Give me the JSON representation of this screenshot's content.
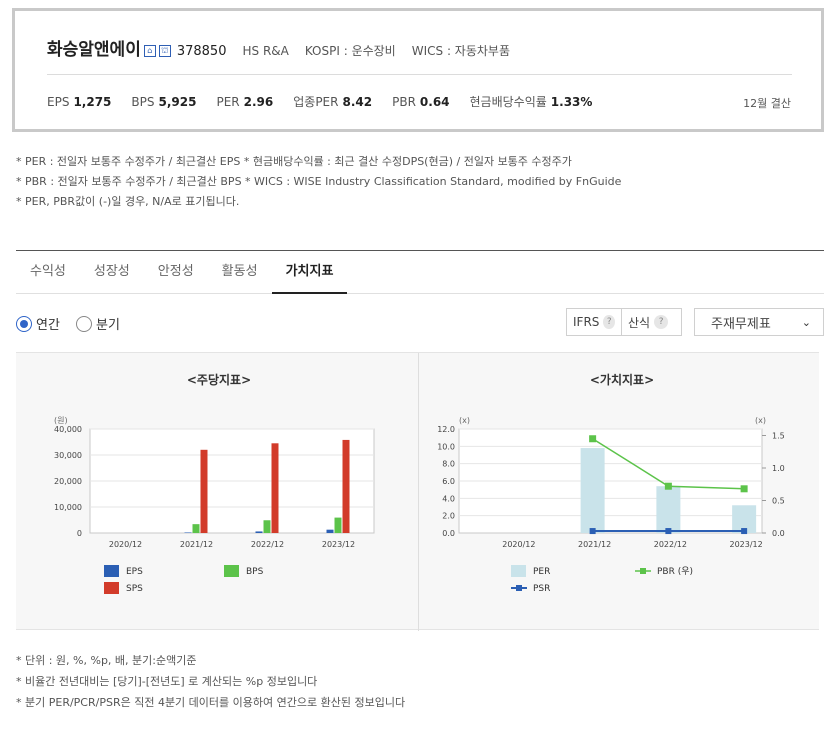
{
  "header": {
    "corp_name": "화승알앤에이",
    "icon_a": "⌂",
    "icon_b": "⛫",
    "code": "378850",
    "english_name": "HS R&A",
    "market": "KOSPI : 운수장비",
    "wics": "WICS : 자동차부품",
    "metrics": [
      {
        "label": "EPS",
        "value": "1,275"
      },
      {
        "label": "BPS",
        "value": "5,925"
      },
      {
        "label": "PER",
        "value": "2.96"
      },
      {
        "label": "업종PER",
        "value": "8.42"
      },
      {
        "label": "PBR",
        "value": "0.64"
      },
      {
        "label": "현금배당수익률",
        "value": "1.33%"
      }
    ],
    "settlement": "12월 결산"
  },
  "notes_top": [
    "* PER : 전일자 보통주 수정주가 / 최근결산 EPS * 현금배당수익률 : 최근 결산 수정DPS(현금) / 전일자 보통주 수정주가",
    "* PBR : 전일자 보통주 수정주가 / 최근결산 BPS * WICS : WISE Industry Classification Standard, modified by FnGuide",
    "* PER, PBR값이 (-)일 경우, N/A로 표기됩니다."
  ],
  "tabs": [
    "수익성",
    "성장성",
    "안정성",
    "활동성",
    "가치지표"
  ],
  "active_tab": 4,
  "controls": {
    "annual_label": "연간",
    "quarter_label": "분기",
    "ifrs_label": "IFRS",
    "calc_label": "산식",
    "help_glyph": "?",
    "select_value": "주재무제표",
    "chevron": "⌄"
  },
  "colors": {
    "eps": "#2b5fb4",
    "bps": "#5cc34a",
    "sps": "#d23b2a",
    "per": "#c9e3ea",
    "pbr": "#5cc34a",
    "psr": "#2b5fb4"
  },
  "chart_data": [
    {
      "type": "bar",
      "title": "<주당지표>",
      "ylabel": "(원)",
      "categories": [
        "2020/12",
        "2021/12",
        "2022/12",
        "2023/12"
      ],
      "ylim": [
        0,
        40000
      ],
      "yticks": [
        "0",
        "10,000",
        "20,000",
        "30,000",
        "40,000"
      ],
      "series": [
        {
          "name": "EPS",
          "values": [
            null,
            200,
            600,
            1275
          ]
        },
        {
          "name": "BPS",
          "values": [
            null,
            3400,
            4900,
            5925
          ]
        },
        {
          "name": "SPS",
          "values": [
            null,
            32000,
            34500,
            35800
          ]
        }
      ]
    },
    {
      "type": "bar",
      "title": "<가치지표>",
      "ylabel": "(x)",
      "y2label": "(x)",
      "categories": [
        "2020/12",
        "2021/12",
        "2022/12",
        "2023/12"
      ],
      "ylim": [
        0,
        12
      ],
      "yticks": [
        "0.0",
        "2.0",
        "4.0",
        "6.0",
        "8.0",
        "10.0",
        "12.0"
      ],
      "y2lim": [
        0,
        1.6
      ],
      "y2ticks": [
        "0.0",
        "0.5",
        "1.0",
        "1.5"
      ],
      "series": [
        {
          "name": "PER",
          "values": [
            null,
            9.8,
            5.4,
            3.2
          ]
        },
        {
          "name": "PBR (우)",
          "values": [
            null,
            1.45,
            0.72,
            0.68
          ]
        },
        {
          "name": "PSR",
          "values": [
            null,
            0.03,
            0.03,
            0.03
          ]
        }
      ]
    }
  ],
  "notes_bottom": [
    "* 단위 : 원, %, %p, 배, 분기:순액기준",
    "* 비율간 전년대비는 [당기]-[전년도] 로 계산되는 %p 정보입니다",
    "* 분기 PER/PCR/PSR은 직전 4분기 데이터를 이용하여 연간으로 환산된 정보입니다"
  ]
}
